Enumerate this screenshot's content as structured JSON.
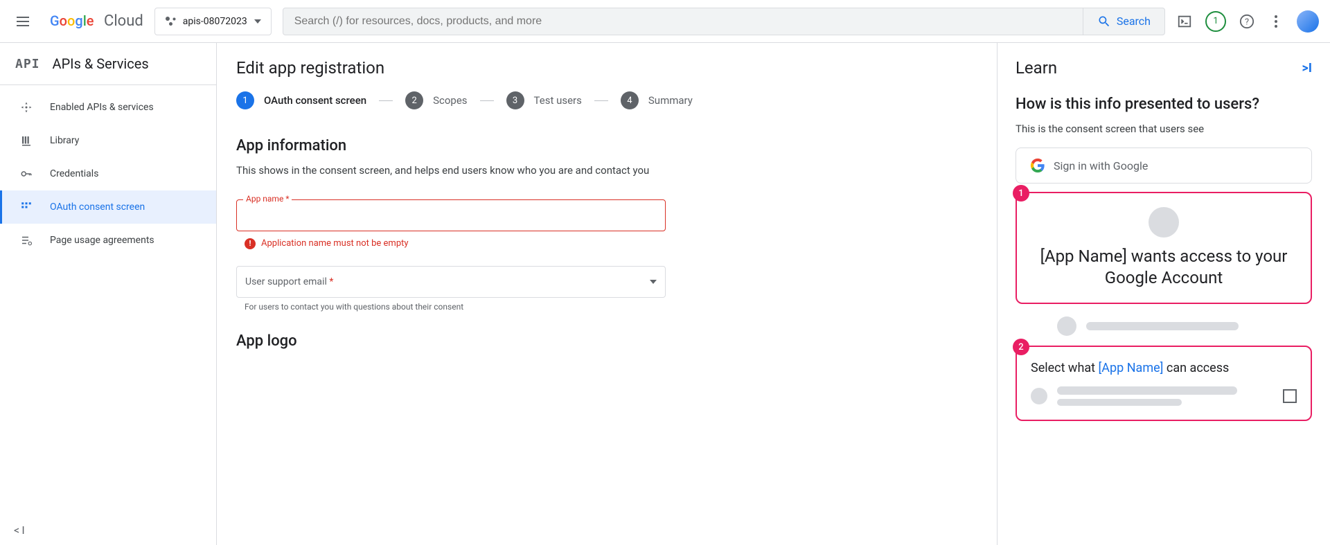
{
  "header": {
    "project_name": "apis-08072023",
    "search_placeholder": "Search (/) for resources, docs, products, and more",
    "search_button": "Search",
    "notification_count": "1"
  },
  "brand": {
    "name_suffix": "Cloud"
  },
  "sidebar": {
    "title": "APIs & Services",
    "api_label": "API",
    "items": [
      {
        "label": "Enabled APIs & services"
      },
      {
        "label": "Library"
      },
      {
        "label": "Credentials"
      },
      {
        "label": "OAuth consent screen"
      },
      {
        "label": "Page usage agreements"
      }
    ]
  },
  "content": {
    "title": "Edit app registration",
    "steps": [
      {
        "num": "1",
        "label": "OAuth consent screen"
      },
      {
        "num": "2",
        "label": "Scopes"
      },
      {
        "num": "3",
        "label": "Test users"
      },
      {
        "num": "4",
        "label": "Summary"
      }
    ],
    "section": {
      "title": "App information",
      "description": "This shows in the consent screen, and helps end users know who you are and contact you"
    },
    "app_name_field": {
      "label": "App name",
      "error": "Application name must not be empty"
    },
    "support_email_field": {
      "label": "User support email",
      "hint": "For users to contact you with questions about their consent"
    },
    "app_logo_section": "App logo"
  },
  "learn": {
    "title": "Learn",
    "question": "How is this info presented to users?",
    "description": "This is the consent screen that users see",
    "signin_text": "Sign in with Google",
    "callout1": {
      "num": "1",
      "text": "[App Name] wants access to your Google Account"
    },
    "callout2": {
      "num": "2",
      "prefix": "Select what ",
      "app": "[App Name]",
      "suffix": " can access"
    }
  }
}
